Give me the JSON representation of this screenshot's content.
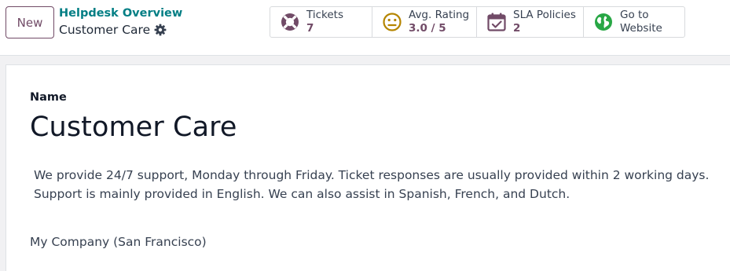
{
  "control_panel": {
    "new_button_label": "New",
    "breadcrumb": {
      "parent": "Helpdesk Overview",
      "current": "Customer Care"
    },
    "settings_icon": "gear-icon"
  },
  "stat_buttons": [
    {
      "icon": "lifebuoy-icon",
      "label": "Tickets",
      "value": "7"
    },
    {
      "icon": "meh-face-icon",
      "label": "Avg. Rating",
      "value": "3.0 / 5"
    },
    {
      "icon": "calendar-check-icon",
      "label": "SLA Policies",
      "value": "2"
    },
    {
      "icon": "globe-icon",
      "label": "Go to",
      "label_line2": "Website"
    }
  ],
  "form": {
    "name_label": "Name",
    "name_value": "Customer Care",
    "description_lines": [
      "We provide 24/7 support, Monday through Friday. Ticket responses are usually provided within 2 working days.",
      "Support is mainly provided in English. We can also assist in Spanish, French, and Dutch."
    ],
    "company": "My Company (San Francisco)"
  },
  "colors": {
    "brand": "#714b67",
    "link": "#017e84",
    "rating_face": "#b58500",
    "website_globe": "#28a745",
    "icon_purple": "#714b67"
  }
}
